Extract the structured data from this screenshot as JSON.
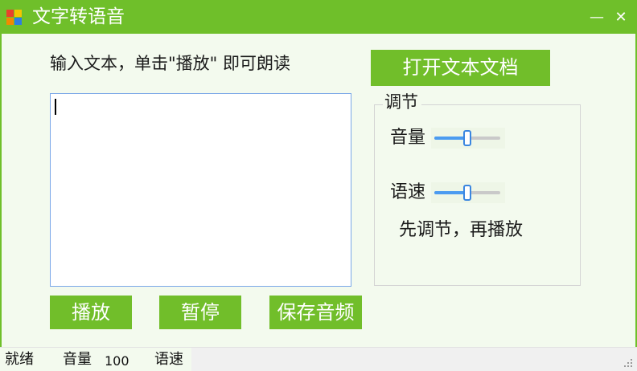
{
  "window": {
    "title": "文字转语音",
    "minimize_glyph": "—",
    "close_glyph": "✕",
    "icon": "winforms-app-icon"
  },
  "main": {
    "hint": "输入文本，单击\"播放\" 即可朗读",
    "open_button": "打开文本文档",
    "text_value": "",
    "play_button": "播放",
    "pause_button": "暂停",
    "save_button": "保存音频"
  },
  "adjust": {
    "group_title": "调节",
    "volume_label": "音量",
    "volume_level": 0.5,
    "rate_label": "语速",
    "rate_level": 0.5,
    "note": "先调节，再播放"
  },
  "status": {
    "state": "就绪",
    "volume_label": "音量",
    "volume_value": "100",
    "rate_label": "语速"
  },
  "colors": {
    "accent": "#6fbf2a",
    "background": "#f3faee",
    "slider_fill": "#4b9bf0"
  }
}
